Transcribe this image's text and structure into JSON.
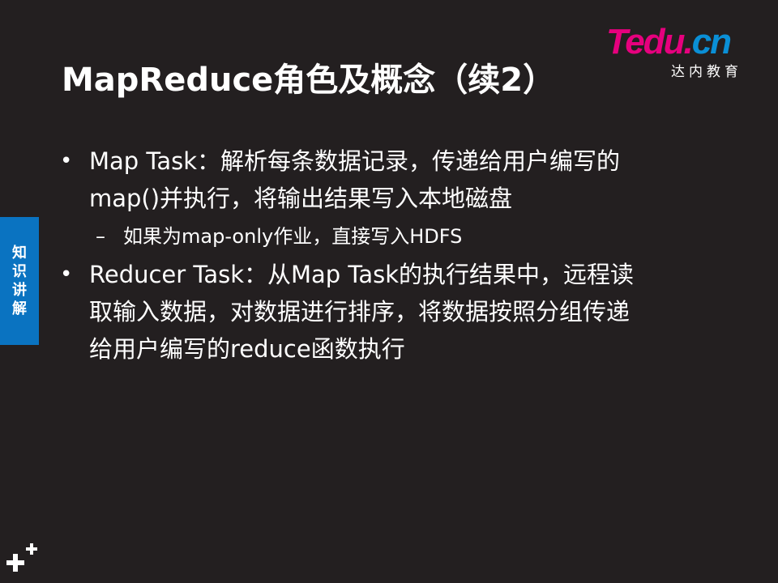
{
  "slide": {
    "title": "MapReduce角色及概念（续2）",
    "logo": {
      "brand_t": "T",
      "brand_rest": "edu.",
      "brand_cn": "cn",
      "subtitle": "达内教育"
    },
    "side_tab": {
      "chars": [
        "知",
        "识",
        "讲",
        "解"
      ]
    },
    "bullets": [
      {
        "marker": "•",
        "lines": [
          "Map Task：解析每条数据记录，传递给用户编写的",
          "map()并执行，将输出结果写入本地磁盘"
        ]
      },
      {
        "marker": "–",
        "text": "如果为map-only作业，直接写入HDFS"
      },
      {
        "marker": "•",
        "lines": [
          "Reducer Task：从Map Task的执行结果中，远程读",
          "取输入数据，对数据进行排序，将数据按照分组传递",
          "给用户编写的reduce函数执行"
        ]
      }
    ],
    "colors": {
      "background": "#231f20",
      "tab_blue": "#0a73c1",
      "logo_magenta": "#e6007e",
      "logo_blue": "#0a8fd6"
    }
  }
}
